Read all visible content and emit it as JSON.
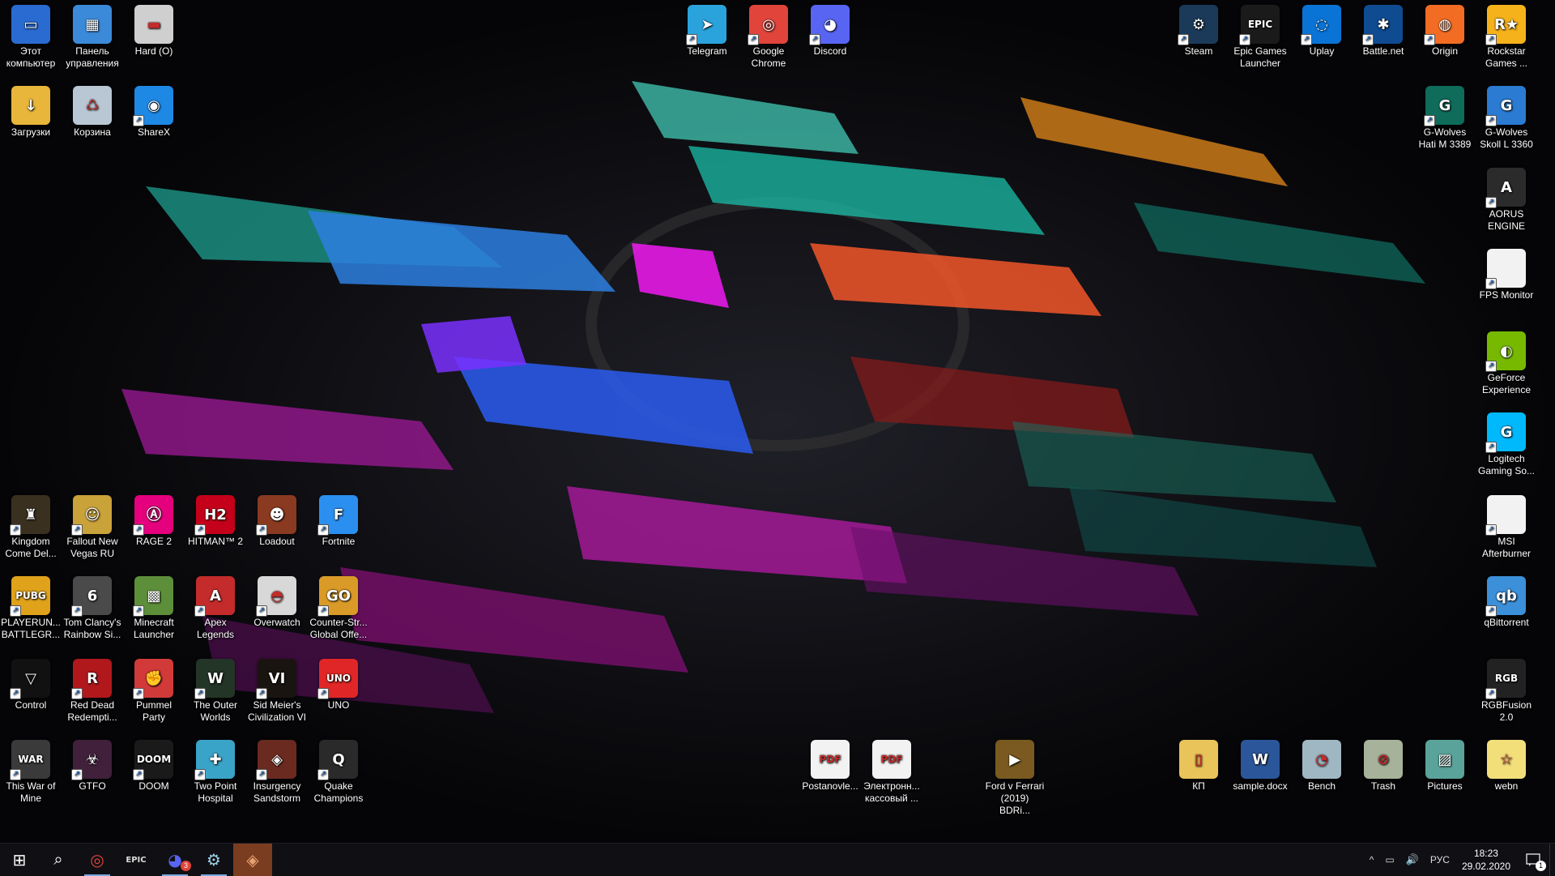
{
  "desktop": {
    "icons": [
      {
        "id": "this-pc",
        "line1": "Этот",
        "line2": "компьютер",
        "glyph": "▭",
        "bg": "#2a6bd1",
        "shortcut": false
      },
      {
        "id": "control-panel",
        "line1": "Панель",
        "line2": "управления",
        "glyph": "▦",
        "bg": "#3b8ad9",
        "shortcut": false
      },
      {
        "id": "hard-drive",
        "line1": "Hard (O)",
        "line2": "",
        "glyph": "▬",
        "bg": "#cfcfcf",
        "shortcut": false
      },
      {
        "id": "downloads",
        "line1": "Загрузки",
        "line2": "",
        "glyph": "↓",
        "bg": "#e7b63b",
        "shortcut": false
      },
      {
        "id": "recycle-bin",
        "line1": "Корзина",
        "line2": "",
        "glyph": "♺",
        "bg": "#b9c6d3",
        "shortcut": false
      },
      {
        "id": "sharex",
        "line1": "ShareX",
        "line2": "",
        "glyph": "◉",
        "bg": "#1e88e5",
        "shortcut": true
      },
      {
        "id": "telegram",
        "line1": "Telegram",
        "line2": "",
        "glyph": "➤",
        "bg": "#2aa3dd",
        "shortcut": true
      },
      {
        "id": "google-chrome",
        "line1": "Google",
        "line2": "Chrome",
        "glyph": "◎",
        "bg": "#e0443a",
        "shortcut": true
      },
      {
        "id": "discord",
        "line1": "Discord",
        "line2": "",
        "glyph": "◕",
        "bg": "#5865f2",
        "shortcut": true
      },
      {
        "id": "steam",
        "line1": "Steam",
        "line2": "",
        "glyph": "⚙",
        "bg": "#1b3a5a",
        "shortcut": true
      },
      {
        "id": "epic-games",
        "line1": "Epic Games",
        "line2": "Launcher",
        "glyph": "EPIC",
        "bg": "#1a1a1a",
        "shortcut": true
      },
      {
        "id": "uplay",
        "line1": "Uplay",
        "line2": "",
        "glyph": "◌",
        "bg": "#0a74d6",
        "shortcut": true
      },
      {
        "id": "battlenet",
        "line1": "Battle.net",
        "line2": "",
        "glyph": "✱",
        "bg": "#0f4b91",
        "shortcut": true
      },
      {
        "id": "origin",
        "line1": "Origin",
        "line2": "",
        "glyph": "◍",
        "bg": "#f26c23",
        "shortcut": true
      },
      {
        "id": "rockstar",
        "line1": "Rockstar",
        "line2": "Games ...",
        "glyph": "R★",
        "bg": "#f6b21b",
        "shortcut": true
      },
      {
        "id": "gwolves-hati",
        "line1": "G-Wolves",
        "line2": "Hati M 3389",
        "glyph": "G",
        "bg": "#0f6b5a",
        "shortcut": true
      },
      {
        "id": "gwolves-skoll",
        "line1": "G-Wolves",
        "line2": "Skoll L 3360",
        "glyph": "G",
        "bg": "#2a7bd1",
        "shortcut": true
      },
      {
        "id": "aorus-engine",
        "line1": "AORUS",
        "line2": "ENGINE",
        "glyph": "A",
        "bg": "#2b2b2b",
        "shortcut": true
      },
      {
        "id": "fps-monitor",
        "line1": "FPS Monitor",
        "line2": "",
        "glyph": "",
        "bg": "#f2f2f2",
        "shortcut": true
      },
      {
        "id": "geforce-experience",
        "line1": "GeForce",
        "line2": "Experience",
        "glyph": "◐",
        "bg": "#76b900",
        "shortcut": true
      },
      {
        "id": "logitech-gaming",
        "line1": "Logitech",
        "line2": "Gaming So...",
        "glyph": "G",
        "bg": "#00b8fc",
        "shortcut": true
      },
      {
        "id": "msi-afterburner",
        "line1": "MSI",
        "line2": "Afterburner",
        "glyph": "",
        "bg": "#f2f2f2",
        "shortcut": true
      },
      {
        "id": "qbittorrent",
        "line1": "qBittorrent",
        "line2": "",
        "glyph": "qb",
        "bg": "#3c8fd9",
        "shortcut": true
      },
      {
        "id": "rgbfusion",
        "line1": "RGBFusion",
        "line2": "2.0",
        "glyph": "RGB",
        "bg": "#222",
        "shortcut": true
      },
      {
        "id": "kingdom-come",
        "line1": "Kingdom",
        "line2": "Come Del...",
        "glyph": "♜",
        "bg": "#3a3020",
        "shortcut": true
      },
      {
        "id": "fallout-nv",
        "line1": "Fallout New",
        "line2": "Vegas RU",
        "glyph": "☺",
        "bg": "#c9a23a",
        "shortcut": true
      },
      {
        "id": "rage2",
        "line1": "RAGE 2",
        "line2": "",
        "glyph": "Ⓐ",
        "bg": "#e5007e",
        "shortcut": true
      },
      {
        "id": "hitman2",
        "line1": "HITMAN™ 2",
        "line2": "",
        "glyph": "H2",
        "bg": "#c4001a",
        "shortcut": true
      },
      {
        "id": "loadout",
        "line1": "Loadout",
        "line2": "",
        "glyph": "☻",
        "bg": "#8a3a20",
        "shortcut": true
      },
      {
        "id": "fortnite",
        "line1": "Fortnite",
        "line2": "",
        "glyph": "F",
        "bg": "#2b8ff0",
        "shortcut": true
      },
      {
        "id": "pubg",
        "line1": "PLAYERUN...",
        "line2": "BATTLEGR...",
        "glyph": "PUBG",
        "bg": "#e0a21a",
        "shortcut": true
      },
      {
        "id": "rainbow-six",
        "line1": "Tom Clancy's",
        "line2": "Rainbow Si...",
        "glyph": "6",
        "bg": "#4a4a4a",
        "shortcut": true
      },
      {
        "id": "minecraft",
        "line1": "Minecraft",
        "line2": "Launcher",
        "glyph": "▩",
        "bg": "#5d8f3a",
        "shortcut": true
      },
      {
        "id": "apex",
        "line1": "Apex",
        "line2": "Legends",
        "glyph": "A",
        "bg": "#c42b2b",
        "shortcut": true
      },
      {
        "id": "overwatch",
        "line1": "Overwatch",
        "line2": "",
        "glyph": "◓",
        "bg": "#d8d8d8",
        "shortcut": true
      },
      {
        "id": "csgo",
        "line1": "Counter-Str...",
        "line2": "Global Offe...",
        "glyph": "GO",
        "bg": "#d99a27",
        "shortcut": true
      },
      {
        "id": "control",
        "line1": "Control",
        "line2": "",
        "glyph": "▽",
        "bg": "#111",
        "shortcut": true
      },
      {
        "id": "rdr2",
        "line1": "Red Dead",
        "line2": "Redempti...",
        "glyph": "R",
        "bg": "#b0181c",
        "shortcut": true
      },
      {
        "id": "pummel-party",
        "line1": "Pummel",
        "line2": "Party",
        "glyph": "✊",
        "bg": "#d23a3a",
        "shortcut": true
      },
      {
        "id": "outer-worlds",
        "line1": "The Outer",
        "line2": "Worlds",
        "glyph": "W",
        "bg": "#233526",
        "shortcut": true
      },
      {
        "id": "civ6",
        "line1": "Sid Meier's",
        "line2": "Civilization VI",
        "glyph": "VI",
        "bg": "#1a1410",
        "shortcut": true
      },
      {
        "id": "uno",
        "line1": "UNO",
        "line2": "",
        "glyph": "UNO",
        "bg": "#e02626",
        "shortcut": true
      },
      {
        "id": "this-war-of-mine",
        "line1": "This War of",
        "line2": "Mine",
        "glyph": "WAR",
        "bg": "#3a3a3a",
        "shortcut": true
      },
      {
        "id": "gtfo",
        "line1": "GTFO",
        "line2": "",
        "glyph": "☣",
        "bg": "#40203a",
        "shortcut": true
      },
      {
        "id": "doom",
        "line1": "DOOM",
        "line2": "",
        "glyph": "DOOM",
        "bg": "#1a1a1a",
        "shortcut": true
      },
      {
        "id": "two-point-hospital",
        "line1": "Two Point",
        "line2": "Hospital",
        "glyph": "✚",
        "bg": "#3aa3c8",
        "shortcut": true
      },
      {
        "id": "insurgency",
        "line1": "Insurgency",
        "line2": "Sandstorm",
        "glyph": "◈",
        "bg": "#6a2a20",
        "shortcut": true
      },
      {
        "id": "quake-champions",
        "line1": "Quake",
        "line2": "Champions",
        "glyph": "Q",
        "bg": "#2a2a2a",
        "shortcut": true
      },
      {
        "id": "postanovle-pdf",
        "line1": "Postanovle...",
        "line2": "",
        "glyph": "PDF",
        "bg": "#f2f2f2",
        "shortcut": false
      },
      {
        "id": "elektronn-pdf",
        "line1": "Электронн...",
        "line2": "кассовый ...",
        "glyph": "PDF",
        "bg": "#f2f2f2",
        "shortcut": false
      },
      {
        "id": "ford-v-ferrari",
        "line1": "Ford v Ferrari",
        "line2": "(2019) BDRi...",
        "glyph": "▶",
        "bg": "#7a5a20",
        "shortcut": false
      },
      {
        "id": "kp-folder",
        "line1": "КП",
        "line2": "",
        "glyph": "▯",
        "bg": "#e8c45a",
        "shortcut": false
      },
      {
        "id": "sample-docx",
        "line1": "sample.docx",
        "line2": "",
        "glyph": "W",
        "bg": "#2b579a",
        "shortcut": false
      },
      {
        "id": "bench",
        "line1": "Bench",
        "line2": "",
        "glyph": "◔",
        "bg": "#9fb7c2",
        "shortcut": false
      },
      {
        "id": "trash",
        "line1": "Trash",
        "line2": "",
        "glyph": "⊘",
        "bg": "#a6b39a",
        "shortcut": false
      },
      {
        "id": "pictures",
        "line1": "Pictures",
        "line2": "",
        "glyph": "▨",
        "bg": "#5aa39a",
        "shortcut": false
      },
      {
        "id": "webn",
        "line1": "webn",
        "line2": "",
        "glyph": "☆",
        "bg": "#f2df7a",
        "shortcut": false
      }
    ]
  },
  "taskbar": {
    "start_glyph": "⊞",
    "search_glyph": "⌕",
    "apps": [
      {
        "id": "chrome",
        "glyph": "◎",
        "color": "#e0443a",
        "state": "running"
      },
      {
        "id": "epic",
        "glyph": "EPIC",
        "color": "#ddd",
        "state": ""
      },
      {
        "id": "discord",
        "glyph": "◕",
        "color": "#5865f2",
        "state": "running",
        "badge": "3"
      },
      {
        "id": "steam",
        "glyph": "⚙",
        "color": "#9ccfe8",
        "state": "running"
      },
      {
        "id": "insurgency",
        "glyph": "◈",
        "color": "#e8a070",
        "state": "active"
      }
    ],
    "tray": {
      "chevron": "^",
      "network": "▭",
      "volume": "🔊",
      "language": "РУС",
      "time": "18:23",
      "date": "29.02.2020",
      "notifications_badge": "1"
    }
  }
}
